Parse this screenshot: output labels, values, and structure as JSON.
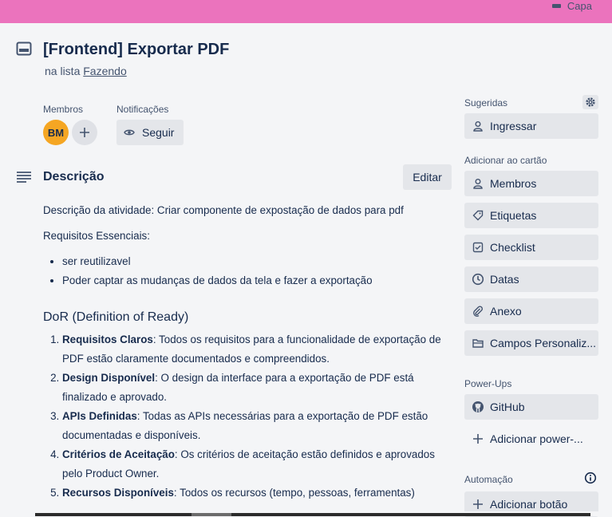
{
  "cover": {
    "label": "Capa"
  },
  "card": {
    "title": "[Frontend] Exportar PDF",
    "list_prefix": "na lista",
    "list_name": "Fazendo"
  },
  "members": {
    "label": "Membros",
    "avatar_initials": "BM"
  },
  "notifications": {
    "label": "Notificações",
    "follow_label": "Seguir"
  },
  "description": {
    "title": "Descrição",
    "edit_label": "Editar",
    "intro": "Descrição da atividade: Criar componente de expostação de dados para pdf",
    "requirements_title": "Requisitos Essenciais:",
    "requirements": [
      "ser reutilizavel",
      "Poder captar as mudanças de dados da tela e fazer a exportação"
    ],
    "dor_title": "DoR (Definition of Ready)",
    "dor_items": [
      {
        "term": "Requisitos Claros",
        "text": ": Todos os requisitos para a funcionalidade de exportação de PDF estão claramente documentados e compreendidos."
      },
      {
        "term": "Design Disponível",
        "text": ": O design da interface para a exportação de PDF está finalizado e aprovado."
      },
      {
        "term": "APIs Definidas",
        "text": ": Todas as APIs necessárias para a exportação de PDF estão documentadas e disponíveis."
      },
      {
        "term": "Critérios de Aceitação",
        "text": ": Os critérios de aceitação estão definidos e aprovados pelo Product Owner."
      },
      {
        "term": "Recursos Disponíveis",
        "text": ": Todos os recursos (tempo, pessoas, ferramentas)"
      }
    ]
  },
  "sidebar": {
    "suggested_heading": "Sugeridas",
    "join_label": "Ingressar",
    "add_heading": "Adicionar ao cartão",
    "add_items": [
      "Membros",
      "Etiquetas",
      "Checklist",
      "Datas",
      "Anexo",
      "Campos Personaliz..."
    ],
    "powerups_heading": "Power-Ups",
    "github_label": "GitHub",
    "add_powerup_label": "Adicionar power-...",
    "automation_heading": "Automação",
    "add_button_label": "Adicionar botão"
  },
  "colors": {
    "cover": "#eb73bd",
    "avatar": "#f5a623",
    "button_bg": "#e4e6ea",
    "text": "#172b4d"
  }
}
